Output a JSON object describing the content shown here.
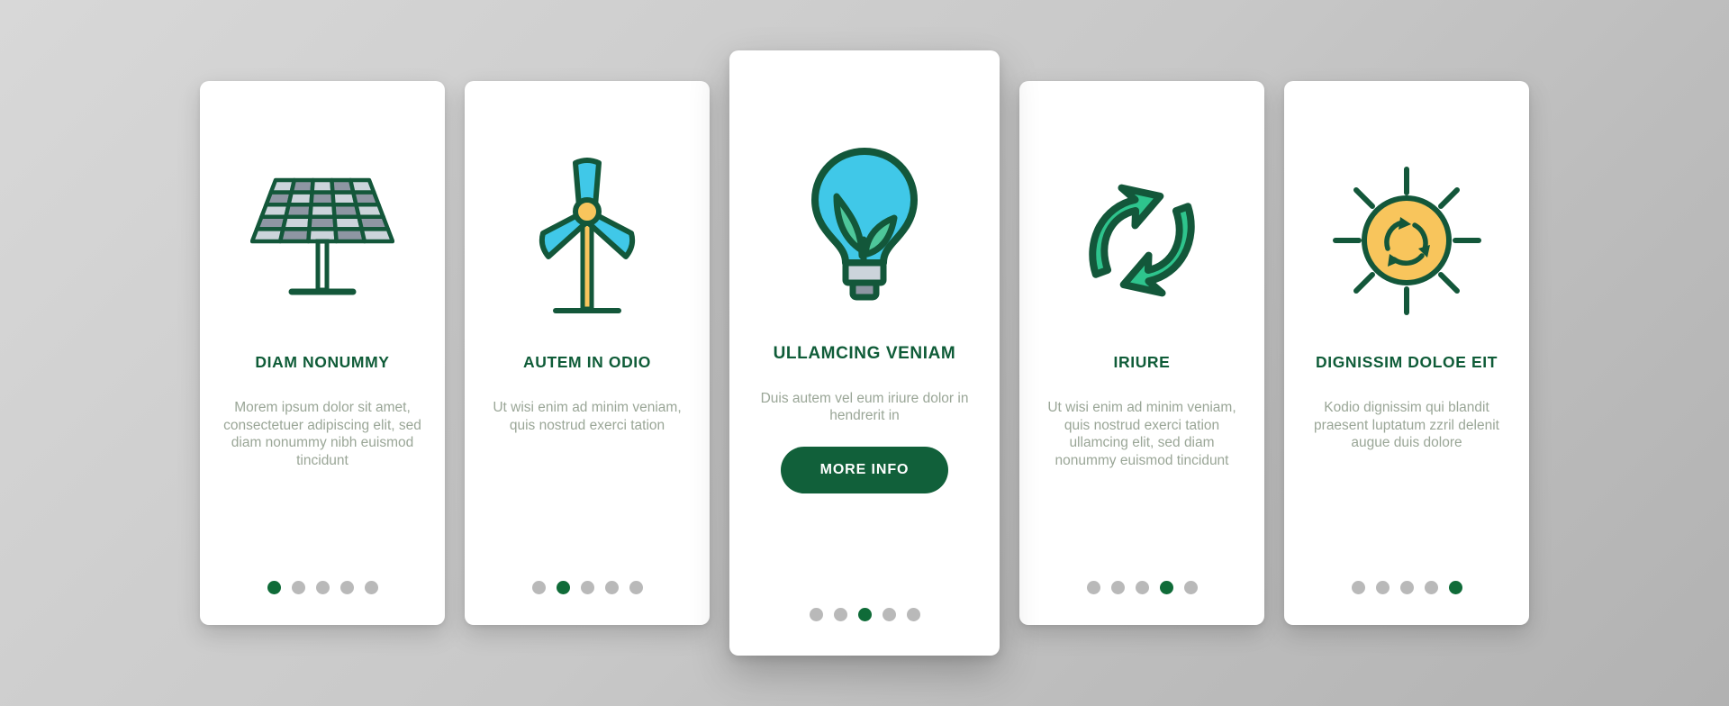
{
  "theme": {
    "heading_color": "#0f5c38",
    "body_color": "#9aa697",
    "accent_green": "#11603a",
    "dot_active": "#0f6b38",
    "dot_inactive": "#b9b9b9",
    "icon_outline": "#13573a",
    "icon_cyan": "#40c8e8",
    "icon_teal": "#2ec48d",
    "icon_yellow": "#f8c55c",
    "icon_gray": "#8e96a3",
    "icon_light_gray": "#ccd4db",
    "card_bg": "#ffffff"
  },
  "cards": [
    {
      "icon": "solar-panel-icon",
      "title": "DIAM NONUMMY",
      "description": "Morem ipsum dolor sit amet, consectetuer adipiscing elit, sed diam nonummy nibh euismod tincidunt",
      "dots_total": 5,
      "dot_active_index": 0,
      "featured": false,
      "button_label": ""
    },
    {
      "icon": "wind-turbine-icon",
      "title": "AUTEM IN ODIO",
      "description": "Ut wisi enim ad minim veniam, quis nostrud exerci tation",
      "dots_total": 5,
      "dot_active_index": 1,
      "featured": false,
      "button_label": ""
    },
    {
      "icon": "eco-lightbulb-icon",
      "title": "ULLAMCING VENIAM",
      "description": "Duis autem vel eum iriure dolor in hendrerit in",
      "dots_total": 5,
      "dot_active_index": 2,
      "featured": true,
      "button_label": "MORE INFO"
    },
    {
      "icon": "recycle-arrows-icon",
      "title": "IRIURE",
      "description": "Ut wisi enim ad minim veniam, quis nostrud exerci tation ullamcing elit, sed diam nonummy euismod tincidunt",
      "dots_total": 5,
      "dot_active_index": 3,
      "featured": false,
      "button_label": ""
    },
    {
      "icon": "sun-recycle-icon",
      "title": "DIGNISSIM DOLOE EIT",
      "description": "Kodio dignissim qui blandit praesent luptatum zzril delenit augue duis dolore",
      "dots_total": 5,
      "dot_active_index": 4,
      "featured": false,
      "button_label": ""
    }
  ]
}
